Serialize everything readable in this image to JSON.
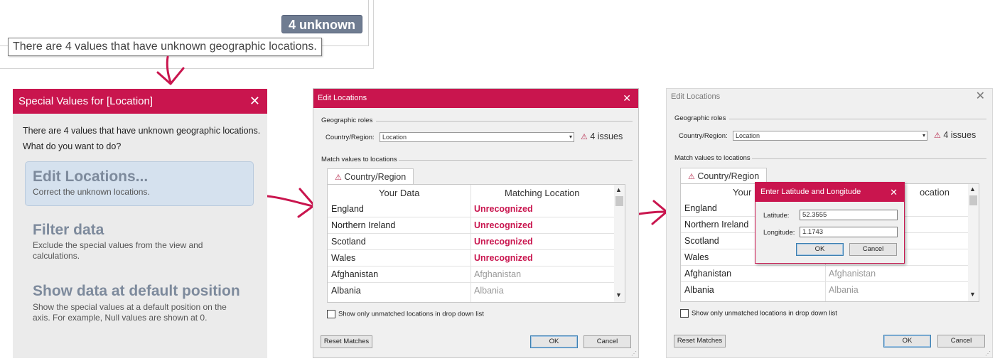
{
  "snippet": {
    "badge": "4 unknown",
    "tooltip": "There are 4 values that have unknown geographic locations."
  },
  "special_values": {
    "title": "Special Values for [Location]",
    "message": "There are 4 values that have unknown geographic locations.",
    "question": "What do you want to do?",
    "options": [
      {
        "title": "Edit Locations...",
        "desc": "Correct the unknown locations."
      },
      {
        "title": "Filter data",
        "desc": "Exclude the special values from the view and calculations."
      },
      {
        "title": "Show data at default position",
        "desc": "Show the special values at a default position on the axis. For example, Null values are shown at 0."
      }
    ]
  },
  "edit_locations": {
    "title": "Edit Locations",
    "geo_roles_label": "Geographic roles",
    "country_label": "Country/Region:",
    "select_value": "Location",
    "issues": "4 issues",
    "match_label": "Match values to locations",
    "tab_label": "Country/Region",
    "col_your_data": "Your Data",
    "col_matching": "Matching Location",
    "rows": [
      {
        "data": "England",
        "match": "Unrecognized",
        "unrecognized": true
      },
      {
        "data": "Northern Ireland",
        "match": "Unrecognized",
        "unrecognized": true
      },
      {
        "data": "Scotland",
        "match": "Unrecognized",
        "unrecognized": true
      },
      {
        "data": "Wales",
        "match": "Unrecognized",
        "unrecognized": true
      },
      {
        "data": "Afghanistan",
        "match": "Afghanistan",
        "unrecognized": false
      },
      {
        "data": "Albania",
        "match": "Albania",
        "unrecognized": false
      }
    ],
    "checkbox_label": "Show only unmatched locations in drop down list",
    "reset_label": "Reset Matches",
    "ok_label": "OK",
    "cancel_label": "Cancel"
  },
  "edit_locations_2": {
    "title": "Edit Locations",
    "col_your_data_partial": "Your",
    "col_matching_partial": "ocation",
    "rows": [
      {
        "data": "England",
        "match": ""
      },
      {
        "data": "Northern Ireland",
        "match": ""
      },
      {
        "data": "Scotland",
        "match": ""
      },
      {
        "data": "Wales",
        "match": ""
      },
      {
        "data": "Afghanistan",
        "match": "Afghanistan"
      },
      {
        "data": "Albania",
        "match": "Albania"
      }
    ]
  },
  "latlong": {
    "title": "Enter Latitude and Longitude",
    "lat_label": "Latitude:",
    "lat_value": "52.3555",
    "long_label": "Longitude:",
    "long_value": "1.1743",
    "ok_label": "OK",
    "cancel_label": "Cancel"
  },
  "colors": {
    "accent": "#c9154e",
    "badge": "#6f7c91",
    "highlight": "#d5e1ee"
  }
}
